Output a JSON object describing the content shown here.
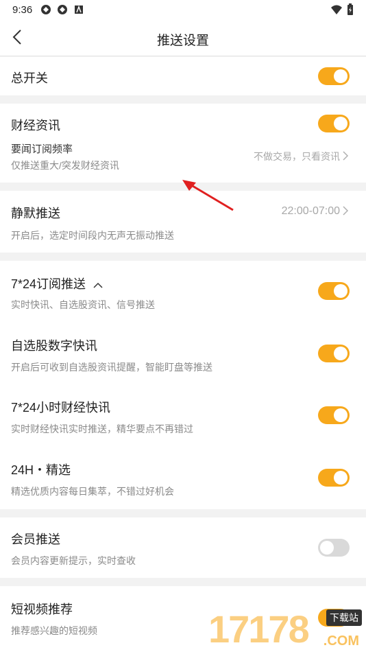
{
  "status_bar": {
    "time": "9:36"
  },
  "nav": {
    "title": "推送设置"
  },
  "master": {
    "label": "总开关",
    "enabled": true
  },
  "finance": {
    "label": "财经资讯",
    "enabled": true,
    "freq_label": "要闻订阅频率",
    "freq_desc": "仅推送重大/突发财经资讯",
    "freq_value": "不做交易，只看资讯"
  },
  "silent": {
    "label": "静默推送",
    "desc": "开启后，选定时间段内无声无振动推送",
    "value": "22:00-07:00"
  },
  "subscriptions": {
    "group_label": "7*24订阅推送",
    "group_desc": "实时快讯、自选股资讯、信号推送",
    "group_enabled": true,
    "items": [
      {
        "label": "自选股数字快讯",
        "desc": "开启后可收到自选股资讯提醒，智能盯盘等推送",
        "enabled": true
      },
      {
        "label": "7*24小时财经快讯",
        "desc": "实时财经快讯实时推送，精华要点不再错过",
        "enabled": true
      },
      {
        "label": "24H・精选",
        "desc": "精选优质内容每日集萃，不错过好机会",
        "enabled": true
      }
    ]
  },
  "member": {
    "label": "会员推送",
    "desc": "会员内容更新提示，实时查收",
    "enabled": false
  },
  "video": {
    "label": "短视频推荐",
    "desc": "推荐感兴趣的短视频",
    "enabled": true
  },
  "watermark": {
    "digits": "17178",
    "badge": "下载站",
    "suffix": ".COM"
  },
  "colors": {
    "accent": "#f7a81b",
    "annotation_arrow": "#e02020"
  }
}
